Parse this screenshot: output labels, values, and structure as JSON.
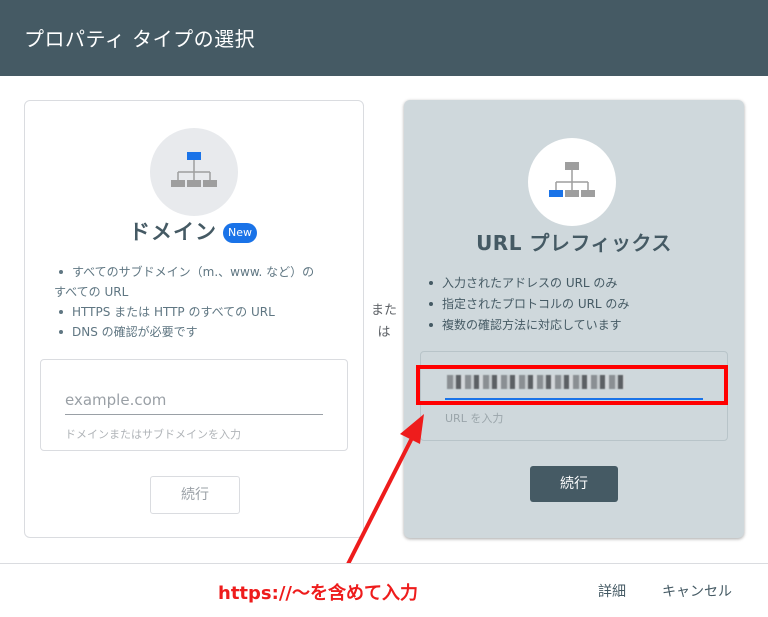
{
  "header": {
    "title": "プロパティ タイプの選択"
  },
  "domain_card": {
    "title": "ドメイン",
    "badge": "New",
    "bullets": [
      {
        "line1": "すべてのサブドメイン（m.、www. など）の",
        "line2": "すべての URL"
      },
      {
        "line1": "HTTPS または HTTP のすべての URL"
      },
      {
        "line1": "DNS の確認が必要です"
      }
    ],
    "input_placeholder": "example.com",
    "input_helper": "ドメインまたはサブドメインを入力",
    "continue_label": "続行",
    "icon": "sitemap-top-selected-icon"
  },
  "separator": {
    "text": "または"
  },
  "url_prefix_card": {
    "title": "URL プレフィックス",
    "bullets": [
      "入力されたアドレスの URL のみ",
      "指定されたプロトコルの URL のみ",
      "複数の確認方法に対応しています"
    ],
    "input_helper": "URL を入力",
    "continue_label": "続行",
    "icon": "sitemap-child-selected-icon"
  },
  "annotation": {
    "text": "https://～を含めて入力",
    "color": "#ee1c1c"
  },
  "footer": {
    "details_label": "詳細",
    "cancel_label": "キャンセル"
  },
  "colors": {
    "header": "#455a64",
    "accent": "#1a73e8",
    "selected_card": "#cfd8dc"
  }
}
